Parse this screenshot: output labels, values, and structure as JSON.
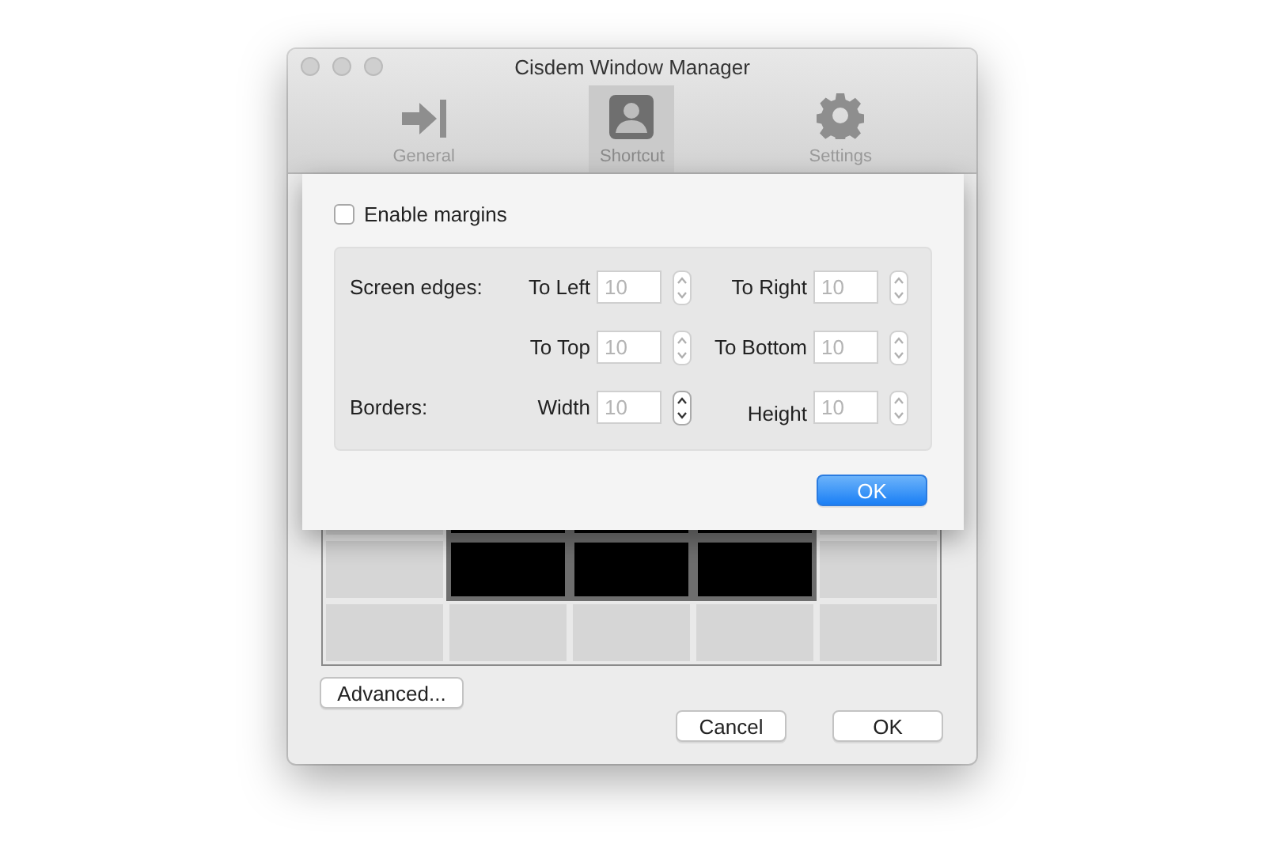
{
  "window": {
    "title": "Cisdem Window Manager"
  },
  "toolbar": [
    {
      "label": "General",
      "selected": false
    },
    {
      "label": "Shortcut",
      "selected": true
    },
    {
      "label": "Settings",
      "selected": false
    }
  ],
  "sheet": {
    "enable_margins": {
      "label": "Enable margins",
      "checked": false
    },
    "rows": [
      {
        "label": "Screen edges:",
        "fields": [
          {
            "label": "To Left",
            "value": "10",
            "disabled": true,
            "stepper_disabled": true
          },
          {
            "label": "To Right",
            "value": "10",
            "disabled": true,
            "stepper_disabled": true
          }
        ]
      },
      {
        "label": "",
        "fields": [
          {
            "label": "To Top",
            "value": "10",
            "disabled": true,
            "stepper_disabled": true
          },
          {
            "label": "To Bottom",
            "value": "10",
            "disabled": true,
            "stepper_disabled": true
          }
        ]
      },
      {
        "label": "Borders:",
        "fields": [
          {
            "label": "Width",
            "value": "10",
            "disabled": true,
            "stepper_disabled": false
          },
          {
            "label": "Height",
            "value": "10",
            "disabled": true,
            "stepper_disabled": true
          }
        ]
      }
    ],
    "ok": "OK"
  },
  "grid": {
    "rows": [
      {
        "cells": [
          {
            "selected": false
          },
          {
            "selected": true
          },
          {
            "selected": true
          },
          {
            "selected": true
          },
          {
            "selected": false
          }
        ]
      },
      {
        "cells": [
          {
            "selected": false
          },
          {
            "selected": true
          },
          {
            "selected": true
          },
          {
            "selected": true
          },
          {
            "selected": false
          }
        ]
      },
      {
        "cells": [
          {
            "selected": false
          },
          {
            "selected": false
          },
          {
            "selected": false
          },
          {
            "selected": false
          },
          {
            "selected": false
          }
        ]
      }
    ]
  },
  "buttons": {
    "advanced": "Advanced...",
    "cancel": "Cancel",
    "ok": "OK"
  }
}
